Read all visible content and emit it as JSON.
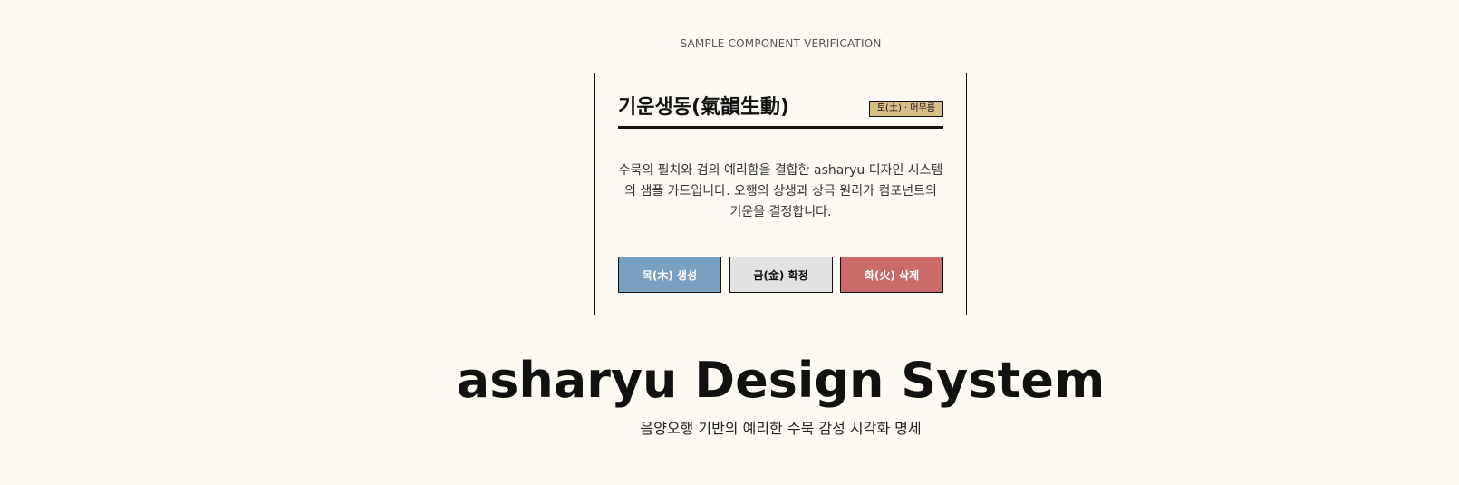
{
  "page": {
    "eyebrow": "SAMPLE COMPONENT VERIFICATION",
    "title": "asharyu Design System",
    "subtitle": "음양오행 기반의 예리한 수묵 감성 시각화 명세"
  },
  "card": {
    "title": "기운생동(氣韻生動)",
    "tag": "토(土) · 머무름",
    "description": "수묵의 필치와 검의 예리함을 결합한 asharyu 디자인 시스템의 샘플 카드입니다. 오행의 상생과 상극 원리가 컴포넌트의 기운을 결정합니다.",
    "buttons": [
      {
        "label": "목(木) 생성",
        "color": "#7aa0c0"
      },
      {
        "label": "금(金) 확정",
        "color": "#e2e2e2"
      },
      {
        "label": "화(火) 삭제",
        "color": "#c96b68"
      }
    ]
  },
  "colors": {
    "background": "#fdfaf3",
    "ink": "#111111",
    "earth": "#d8bd86"
  }
}
